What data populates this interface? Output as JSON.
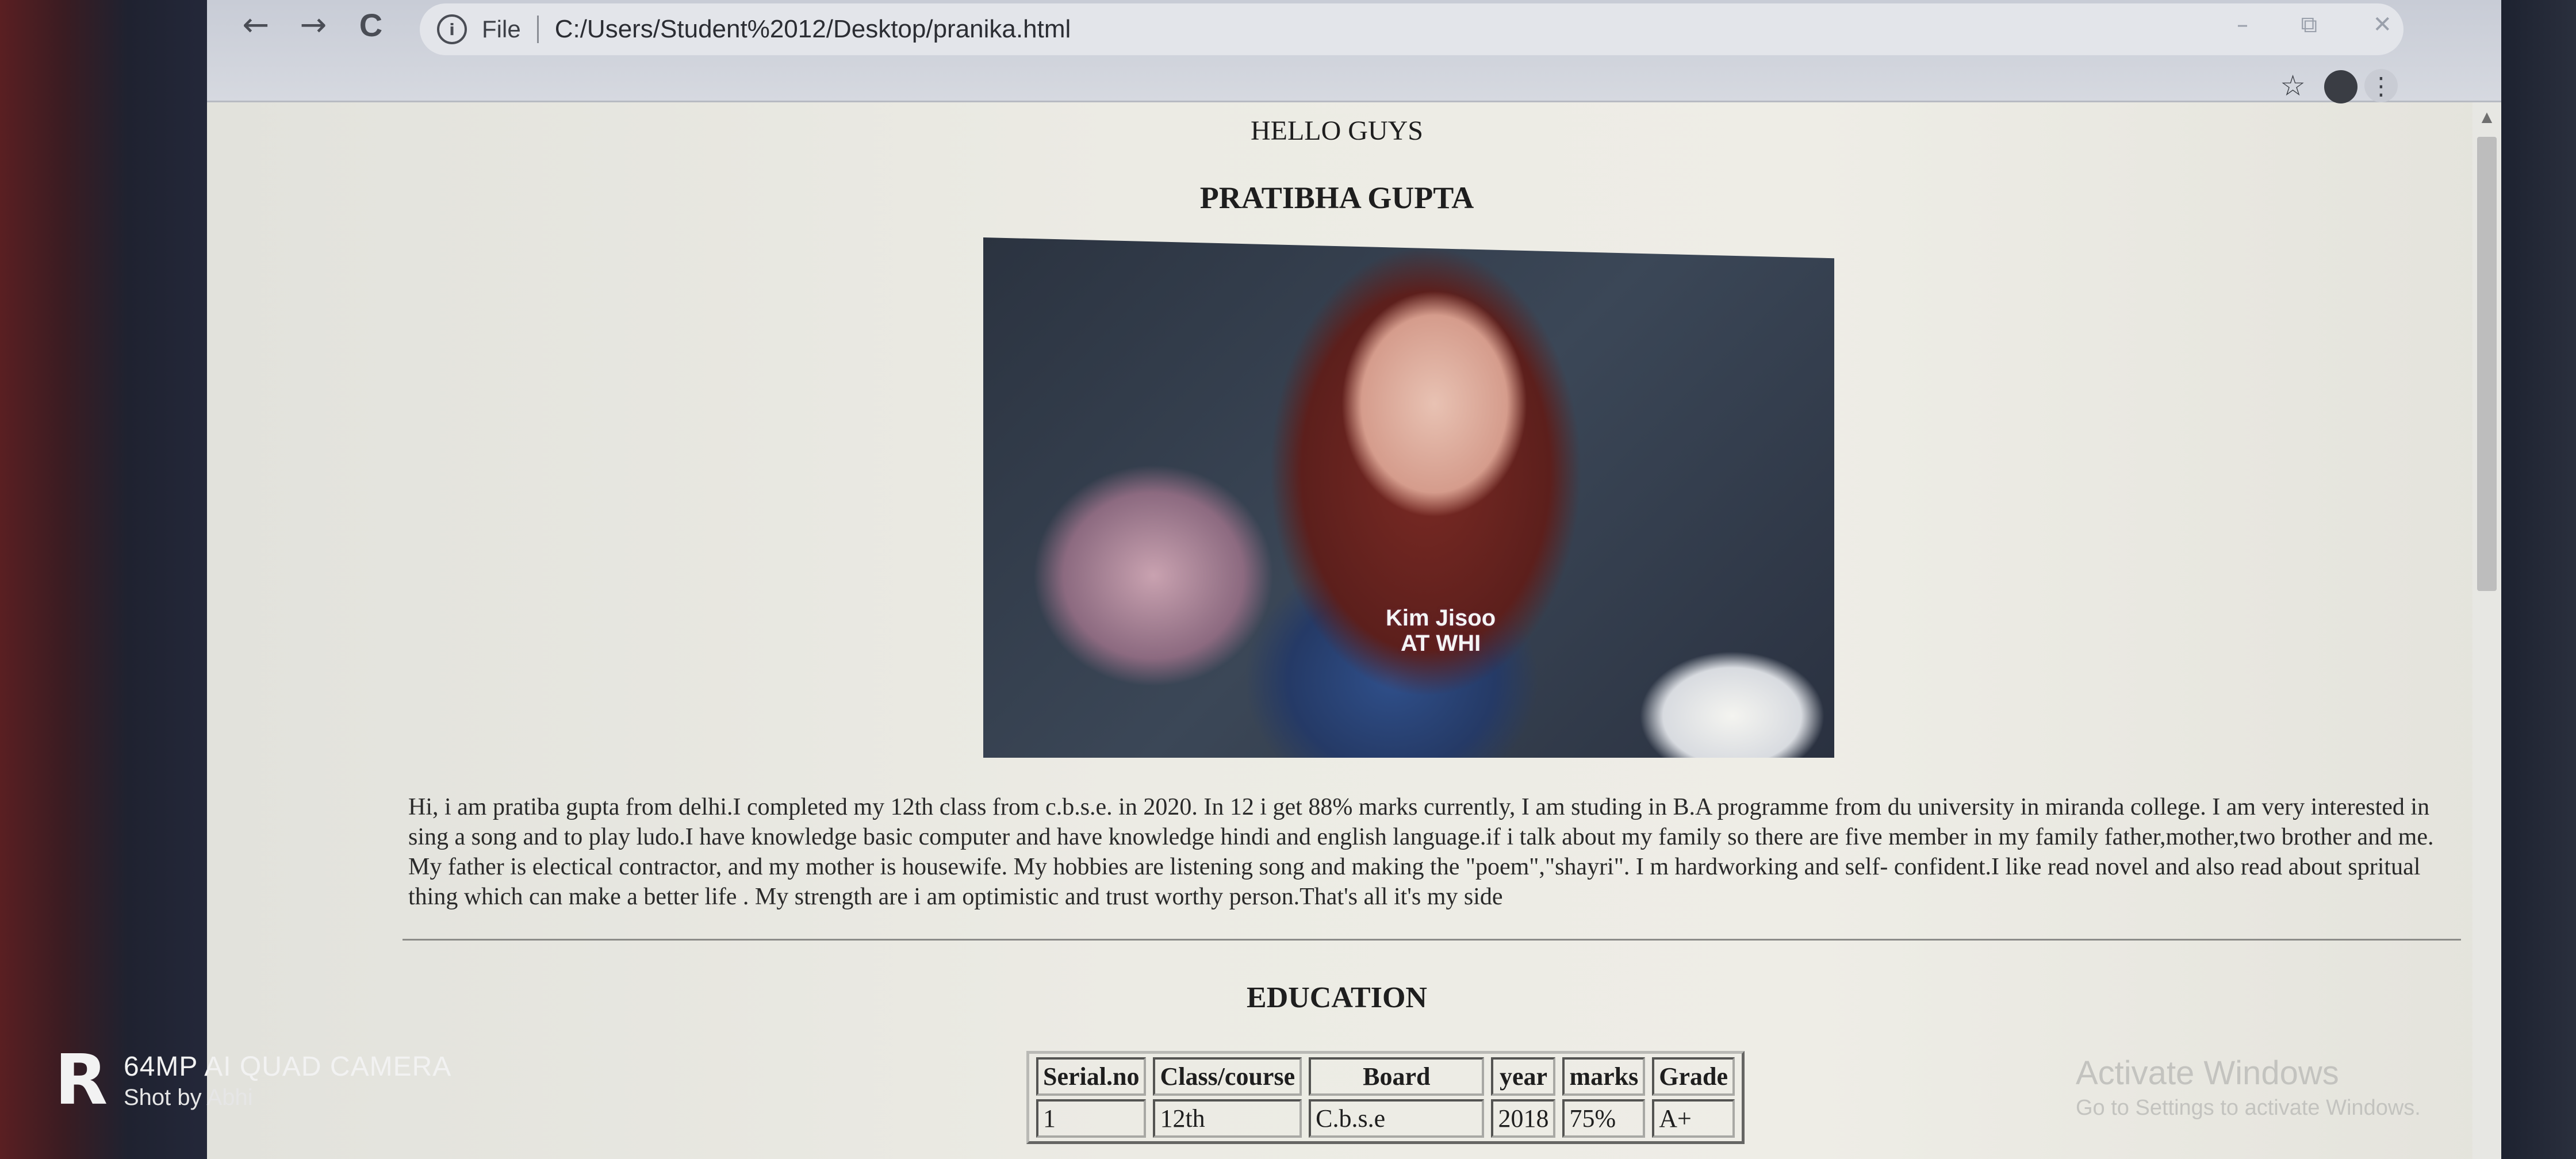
{
  "browser": {
    "back_icon": "←",
    "forward_icon": "→",
    "reload_icon": "C",
    "info_icon": "i",
    "scheme": "File",
    "url": "C:/Users/Student%2012/Desktop/pranika.html",
    "minimize_icon": "–",
    "restore_icon": "⧉",
    "close_icon": "✕",
    "star_icon": "☆",
    "menu_icon": "⋮"
  },
  "page": {
    "greeting": "HELLO GUYS",
    "name": "PRATIBHA GUPTA",
    "photo_caption_line1": "Kim Jisoo",
    "photo_caption_line2": "AT WHI",
    "bio": "Hi, i am pratiba gupta from delhi.I completed my 12th class from c.b.s.e. in 2020. In 12 i get 88% marks currently, I am studing in B.A programme from du university in miranda college. I am very interested in sing a song and to play ludo.I have knowledge basic computer and have knowledge hindi and english language.if i talk about my family so there are five member in my family father,mother,two brother and me. My father is electical contractor, and my mother is housewife. My hobbies are listening song and making the \"poem\",\"shayri\". I m hardworking and self- confident.I like read novel and also read about spritual thing which can make a better life . My strength are i am optimistic and trust worthy person.That's all it's my side",
    "education_heading": "EDUCATION",
    "table": {
      "headers": [
        "Serial.no",
        "Class/course",
        "Board",
        "year",
        "marks",
        "Grade"
      ],
      "rows": [
        [
          "1",
          "12th",
          "C.b.s.e",
          "2018",
          "75%",
          "A+"
        ]
      ]
    }
  },
  "watermark": {
    "line1": "Activate Windows",
    "line2": "Go to Settings to activate Windows."
  },
  "camera_overlay": {
    "logo": "R",
    "line1": "64MP AI QUAD CAMERA",
    "line2": "Shot by Abhi"
  }
}
